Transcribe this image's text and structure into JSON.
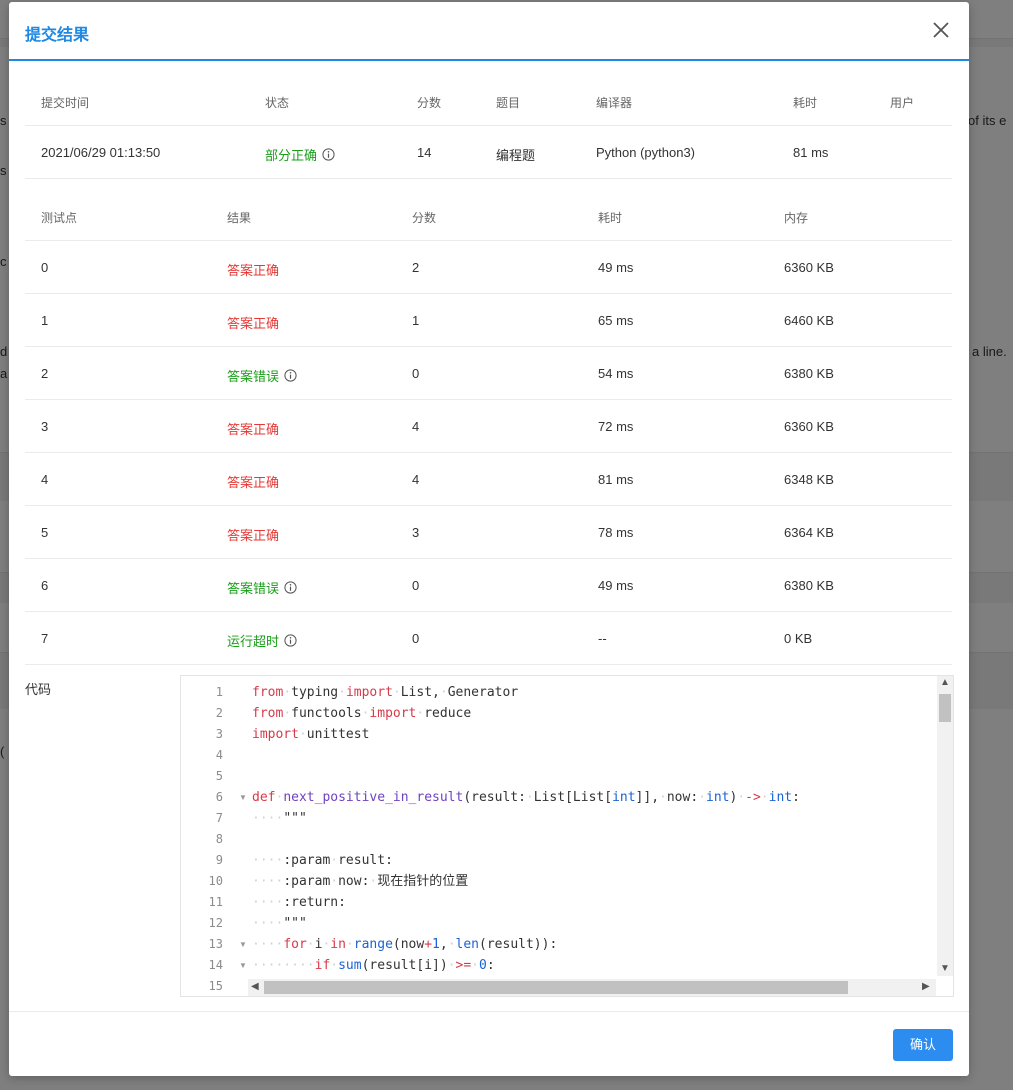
{
  "background_fragments": [
    "s c",
    "of its e",
    "s",
    "c",
    "d",
    "a line.",
    "a",
    "("
  ],
  "modal": {
    "title": "提交结果",
    "close_icon": "close-icon",
    "confirm_label": "确认"
  },
  "submission": {
    "headers": [
      "提交时间",
      "状态",
      "分数",
      "题目",
      "编译器",
      "耗时",
      "用户"
    ],
    "row": {
      "time": "2021/06/29 01:13:50",
      "status": "部分正确",
      "score": "14",
      "problem": "编程题",
      "compiler": "Python (python3)",
      "elapsed": "81 ms",
      "user": ""
    }
  },
  "testcases": {
    "headers": [
      "测试点",
      "结果",
      "分数",
      "耗时",
      "内存"
    ],
    "rows": [
      {
        "id": "0",
        "result": "答案正确",
        "score": "2",
        "time": "49 ms",
        "memory": "6360 KB",
        "kind": "red",
        "info": false
      },
      {
        "id": "1",
        "result": "答案正确",
        "score": "1",
        "time": "65 ms",
        "memory": "6460 KB",
        "kind": "red",
        "info": false
      },
      {
        "id": "2",
        "result": "答案错误",
        "score": "0",
        "time": "54 ms",
        "memory": "6380 KB",
        "kind": "green",
        "info": true
      },
      {
        "id": "3",
        "result": "答案正确",
        "score": "4",
        "time": "72 ms",
        "memory": "6360 KB",
        "kind": "red",
        "info": false
      },
      {
        "id": "4",
        "result": "答案正确",
        "score": "4",
        "time": "81 ms",
        "memory": "6348 KB",
        "kind": "red",
        "info": false
      },
      {
        "id": "5",
        "result": "答案正确",
        "score": "3",
        "time": "78 ms",
        "memory": "6364 KB",
        "kind": "red",
        "info": false
      },
      {
        "id": "6",
        "result": "答案错误",
        "score": "0",
        "time": "49 ms",
        "memory": "6380 KB",
        "kind": "green",
        "info": true
      },
      {
        "id": "7",
        "result": "运行超时",
        "score": "0",
        "time": "--",
        "memory": "0 KB",
        "kind": "green",
        "info": true
      }
    ]
  },
  "code": {
    "label": "代码",
    "line_numbers": [
      "1",
      "2",
      "3",
      "4",
      "5",
      "6",
      "7",
      "8",
      "9",
      "10",
      "11",
      "12",
      "13",
      "14",
      "15"
    ],
    "lines": [
      "from typing import List, Generator",
      "from functools import reduce",
      "import unittest",
      "",
      "",
      "def next_positive_in_result(result: List[List[int]], now: int) -> int:",
      "    \"\"\"",
      "",
      "    :param result:",
      "    :param now: 现在指针的位置",
      "    :return:",
      "    \"\"\"",
      "    for i in range(now+1, len(result)):",
      "        if sum(result[i]) >= 0:",
      ""
    ]
  },
  "colors": {
    "accent": "#1e88e5",
    "status_green": "#1a9e1a",
    "status_red": "#e53935",
    "button": "#2d8cf0"
  }
}
